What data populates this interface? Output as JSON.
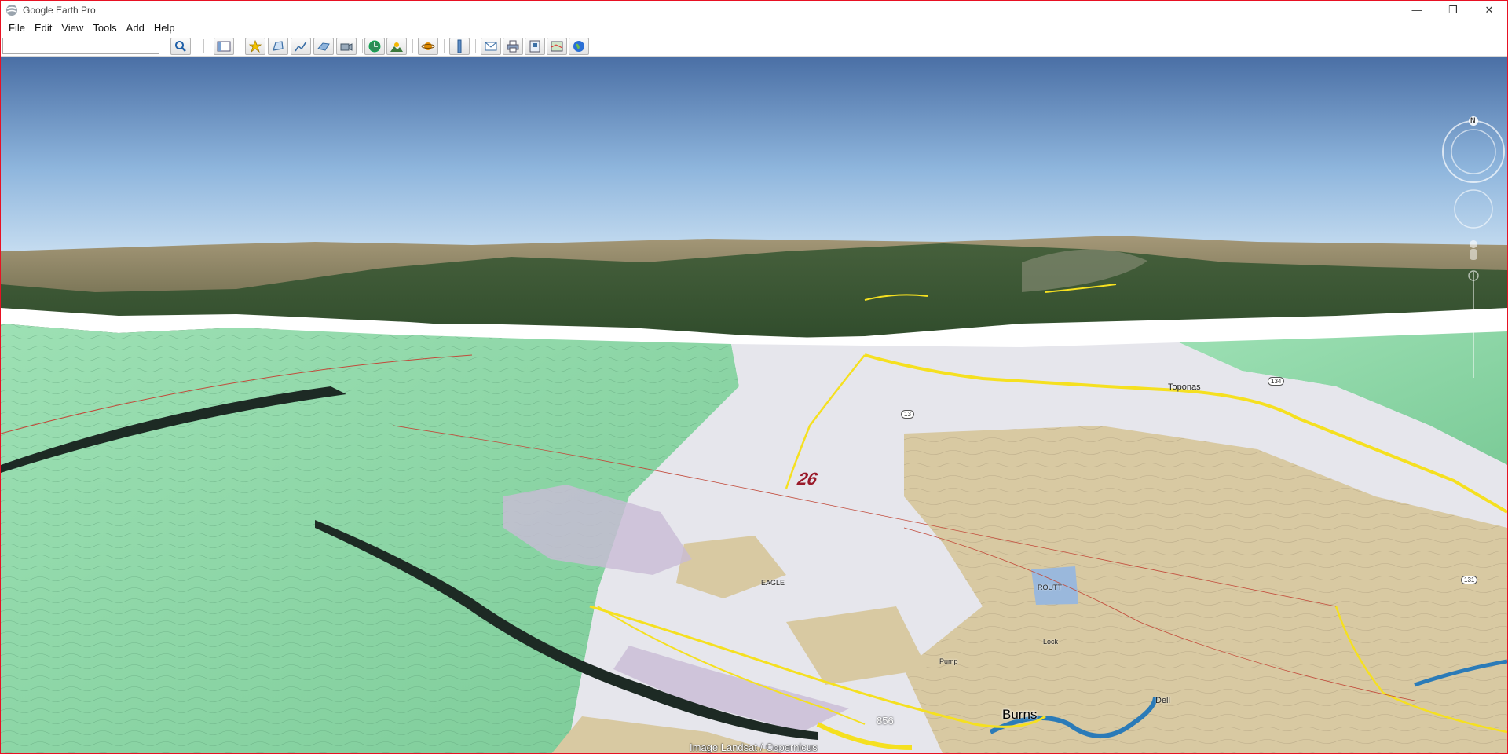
{
  "window": {
    "title": "Google Earth Pro",
    "controls": [
      "—",
      "❐",
      "✕"
    ]
  },
  "menu": {
    "items": [
      "File",
      "Edit",
      "View",
      "Tools",
      "Add",
      "Help"
    ]
  },
  "search": {
    "value": "",
    "placeholder": ""
  },
  "toolbar": {
    "buttons": [
      "search-icon",
      "sidebar-icon",
      "placemark-icon",
      "polygon-icon",
      "path-icon",
      "image-overlay-icon",
      "record-tour-icon",
      "historical-imagery-icon",
      "sunlight-icon",
      "planets-icon",
      "ruler-icon",
      "email-icon",
      "print-icon",
      "save-image-icon",
      "view-in-maps-icon",
      "earth-icon"
    ]
  },
  "map": {
    "labels": {
      "town_main": "Burns",
      "road_856": "856",
      "town_toponas": "Toponas",
      "shield_131": "131",
      "shield_134": "134",
      "shield_13": "13",
      "number_26": "26",
      "label_eagle": "EAGLE",
      "label_routt": "ROUTT",
      "label_pump": "Pump",
      "label_dell": "Dell",
      "label_lock": "Lock"
    },
    "compass_north": "N",
    "attribution": "Image Landsat / Copernicus"
  },
  "colors": {
    "sky_top": "#4a6fa5",
    "sky_horizon": "#e6f4fd",
    "forest_map": "#8fd9a8",
    "blm_tan": "#d8c8a0",
    "private_white": "#e8e8ec",
    "road_yellow": "#f5e020",
    "river_blue": "#2b7bb8",
    "title_border": "#e81123"
  }
}
